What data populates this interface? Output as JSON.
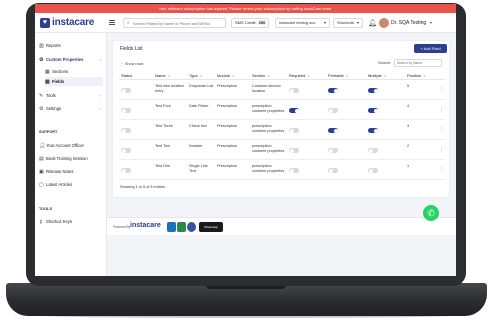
{
  "alert": {
    "text": "Your software subscription has expired. Please renew your subscription by calling InstaCare team."
  },
  "brand": {
    "name": "instacare"
  },
  "topbar": {
    "search_placeholder": "Search Patient by Name or Phone and MRNo",
    "sms_label": "SMS Credit:",
    "sms_value": "250",
    "clinic_select": "instacare testing acc",
    "shortcuts_select": "Shortcuts",
    "user_name": "Dr. SQA Testing"
  },
  "sidebar": {
    "reports": "Reports",
    "custom_properties": "Custom Properties",
    "sections": "Sections",
    "fields": "Fields",
    "tools": "Tools",
    "settings": "Settings",
    "support_heading": "SUPPORT",
    "account_officer": "Your Account Officer",
    "book_training": "Book Training Session",
    "release_notes": "Release Notes",
    "latest_articles": "Latest Articles",
    "tools_heading": "TOOLS",
    "shortcut_keys": "Shortcut Keys"
  },
  "fields_list": {
    "title": "Fields List",
    "add_button": "+ Add Field",
    "show_rows": "Show rows",
    "search_label": "Search:",
    "search_placeholder": "Search by Name",
    "columns": [
      "Status",
      "Name",
      "Type",
      "Module",
      "Section",
      "Required",
      "Printable",
      "Multiple",
      "Position"
    ],
    "rows": [
      {
        "name": "Test new location entry",
        "type": "Dropdown List",
        "module": "Prescription",
        "section": "Custome second location",
        "status": false,
        "required": false,
        "printable": true,
        "multiple": true,
        "position": "5"
      },
      {
        "name": "Test Four",
        "type": "Date Picker",
        "module": "Prescription",
        "section": "prescription custome properties",
        "status": false,
        "required": true,
        "printable": false,
        "multiple": true,
        "position": "4"
      },
      {
        "name": "Test Three",
        "type": "Check box",
        "module": "Prescription",
        "section": "prescription custome properties",
        "status": false,
        "required": false,
        "printable": true,
        "multiple": true,
        "position": "3"
      },
      {
        "name": "Test Two",
        "type": "Number",
        "module": "Prescription",
        "section": "prescription custome properties",
        "status": false,
        "required": false,
        "printable": false,
        "multiple": false,
        "position": "2"
      },
      {
        "name": "Test One",
        "type": "Single Line Text",
        "module": "Prescription",
        "section": "prescription custome properties",
        "status": false,
        "required": false,
        "printable": false,
        "multiple": false,
        "position": "1"
      }
    ],
    "entries_info": "Showing 1 to 5 of 5 entries"
  },
  "footer": {
    "powered_by": "Powered By",
    "logo": "instacare",
    "whatsapp_badge": "WhatsApp"
  }
}
